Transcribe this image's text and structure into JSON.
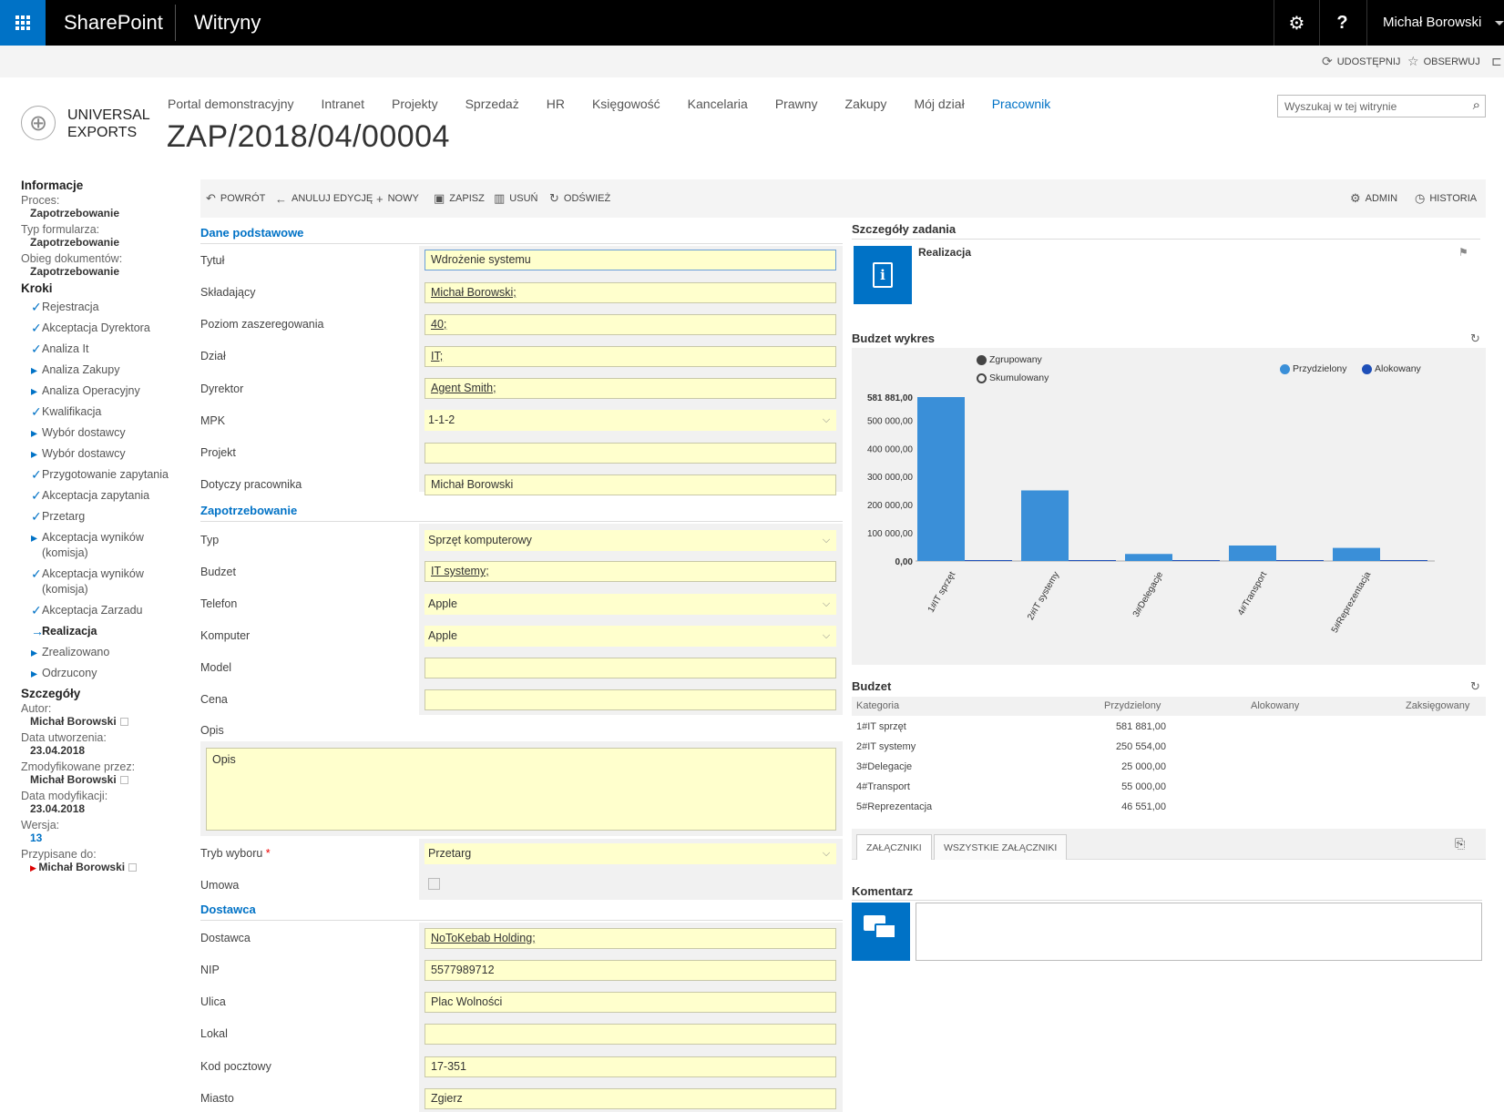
{
  "suite": {
    "brand": "SharePoint",
    "sites": "Witryny",
    "settings_glyph": "⚙",
    "help_glyph": "?",
    "user": "Michał Borowski"
  },
  "ribbon": {
    "share": "UDOSTĘPNIJ",
    "follow": "OBSERWUJ"
  },
  "logo": {
    "line1": "UNIVERSAL",
    "line2": "EXPORTS"
  },
  "topnav": [
    "Portal demonstracyjny",
    "Intranet",
    "Projekty",
    "Sprzedaż",
    "HR",
    "Księgowość",
    "Kancelaria",
    "Prawny",
    "Zakupy",
    "Mój dział",
    "Pracownik"
  ],
  "page_title": "ZAP/2018/04/00004",
  "search": {
    "placeholder": "Wyszukaj w tej witrynie"
  },
  "left": {
    "info_header": "Informacje",
    "process_label": "Proces:",
    "process_value": "Zapotrzebowanie",
    "form_type_label": "Typ formularza:",
    "form_type_value": "Zapotrzebowanie",
    "flow_label": "Obieg dokumentów:",
    "flow_value": "Zapotrzebowanie",
    "steps_header": "Kroki",
    "steps": [
      {
        "label": "Rejestracja",
        "mark": "✓"
      },
      {
        "label": "Akceptacja Dyrektora",
        "mark": "✓"
      },
      {
        "label": "Analiza It",
        "mark": "✓"
      },
      {
        "label": "Analiza Zakupy",
        "mark": "▸"
      },
      {
        "label": "Analiza Operacyjny",
        "mark": "▸"
      },
      {
        "label": "Kwalifikacja",
        "mark": "✓"
      },
      {
        "label": "Wybór dostawcy",
        "mark": "▸"
      },
      {
        "label": "Wybór dostawcy",
        "mark": "▸"
      },
      {
        "label": "Przygotowanie zapytania",
        "mark": "✓"
      },
      {
        "label": "Akceptacja zapytania",
        "mark": "✓"
      },
      {
        "label": "Przetarg",
        "mark": "✓"
      },
      {
        "label": "Akceptacja wyników (komisja)",
        "mark": "▸"
      },
      {
        "label": "Akceptacja wyników (komisja)",
        "mark": "✓"
      },
      {
        "label": "Akceptacja Zarzadu",
        "mark": "✓"
      },
      {
        "label": "Realizacja",
        "mark": "→"
      },
      {
        "label": "Zrealizowano",
        "mark": "▸"
      },
      {
        "label": "Odrzucony",
        "mark": "▸"
      }
    ],
    "details_header": "Szczegóły",
    "author_label": "Autor:",
    "author_value": "Michał Borowski",
    "created_label": "Data utworzenia:",
    "created_value": "23.04.2018",
    "modified_by_label": "Zmodyfikowane przez:",
    "modified_by_value": "Michał Borowski",
    "modified_label": "Data modyfikacji:",
    "modified_value": "23.04.2018",
    "version_label": "Wersja:",
    "version_value": "13",
    "assigned_label": "Przypisane do:",
    "assigned_value": "Michał Borowski"
  },
  "toolbar": {
    "back": "POWRÓT",
    "cancel_edit": "ANULUJ EDYCJĘ",
    "new": "NOWY",
    "save": "ZAPISZ",
    "delete": "USUŃ",
    "refresh": "ODŚWIEŻ",
    "admin": "ADMIN",
    "history": "HISTORIA"
  },
  "form": {
    "section_basic": "Dane podstawowe",
    "title_label": "Tytuł",
    "title_value": "Wdrożenie systemu",
    "submitter_label": "Składający",
    "submitter_value": "Michał Borowski;",
    "grade_label": "Poziom zaszeregowania",
    "grade_value": "40;",
    "dept_label": "Dział",
    "dept_value": "IT;",
    "director_label": "Dyrektor",
    "director_value": "Agent Smith;",
    "mpk_label": "MPK",
    "mpk_value": "1-1-2",
    "project_label": "Projekt",
    "project_value": "",
    "employee_label": "Dotyczy pracownika",
    "employee_value": "Michał Borowski",
    "section_request": "Zapotrzebowanie",
    "type_label": "Typ",
    "type_value": "Sprzęt komputerowy",
    "budget_label": "Budzet",
    "budget_value": "IT systemy;",
    "phone_label": "Telefon",
    "phone_value": "Apple",
    "computer_label": "Komputer",
    "computer_value": "Apple",
    "model_label": "Model",
    "model_value": "",
    "price_label": "Cena",
    "price_value": "",
    "desc_label": "Opis",
    "desc_value": "Opis",
    "mode_label": "Tryb wyboru",
    "mode_required": "*",
    "mode_value": "Przetarg",
    "contract_label": "Umowa",
    "section_supplier": "Dostawca",
    "supplier_label": "Dostawca",
    "supplier_value": "NoToKebab Holding;",
    "nip_label": "NIP",
    "nip_value": "5577989712",
    "street_label": "Ulica",
    "street_value": "Plac Wolności",
    "unit_label": "Lokal",
    "unit_value": "",
    "zip_label": "Kod pocztowy",
    "zip_value": "17-351",
    "city_label": "Miasto",
    "city_value": "Zgierz"
  },
  "task": {
    "header": "Szczegóły zadania",
    "name": "Realizacja"
  },
  "chart_header": "Budzet wykres",
  "chart_options": {
    "grouped": "Zgrupowany",
    "cumulative": "Skumulowany"
  },
  "chart_data": {
    "type": "bar",
    "categories": [
      "1#IT sprzęt",
      "2#IT systemy",
      "3#Delegacje",
      "4#Transport",
      "5#Reprezentacja"
    ],
    "series": [
      {
        "name": "Przydzielony",
        "values": [
          581881.0,
          250554.0,
          25000.0,
          55000.0,
          46551.0
        ],
        "color": "#3a8fd8"
      },
      {
        "name": "Alokowany",
        "values": [
          0,
          0,
          0,
          0,
          0
        ],
        "color": "#1e4fb8"
      }
    ],
    "yticks": [
      "0,00",
      "100 000,00",
      "200 000,00",
      "300 000,00",
      "400 000,00",
      "500 000,00",
      "581 881,00"
    ],
    "ylim": [
      0,
      581881
    ],
    "legend_position": "top-right"
  },
  "budget": {
    "header": "Budzet",
    "columns": [
      "Kategoria",
      "Przydzielony",
      "Alokowany",
      "Zaksięgowany"
    ],
    "rows": [
      [
        "1#IT sprzęt",
        "581 881,00",
        "",
        ""
      ],
      [
        "2#IT systemy",
        "250 554,00",
        "",
        ""
      ],
      [
        "3#Delegacje",
        "25 000,00",
        "",
        ""
      ],
      [
        "4#Transport",
        "55 000,00",
        "",
        ""
      ],
      [
        "5#Reprezentacja",
        "46 551,00",
        "",
        ""
      ]
    ]
  },
  "tabs": {
    "attachments": "ZAŁĄCZNIKI",
    "all_attachments": "WSZYSTKIE ZAŁĄCZNIKI"
  },
  "comments": {
    "header": "Komentarz",
    "value": ""
  },
  "colors": {
    "accent": "#0072c6",
    "field_bg": "#ffffcd",
    "suite_bg": "#000000"
  }
}
